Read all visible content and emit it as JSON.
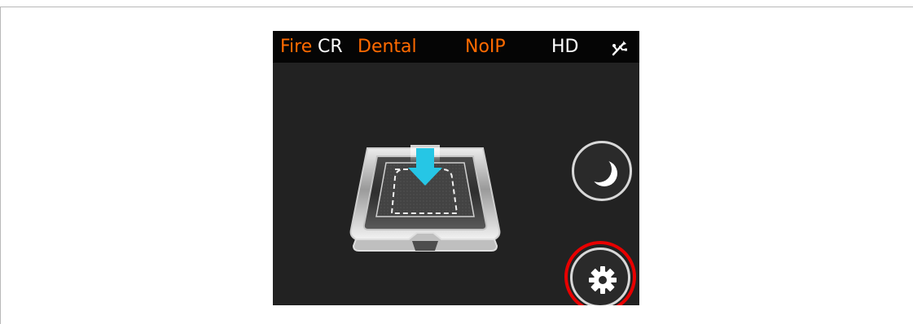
{
  "status_bar": {
    "brand_fire": "Fire",
    "brand_cr": "CR",
    "product": "Dental",
    "network": "NoIP",
    "mode": "HD",
    "connection_icon": "usb-icon"
  },
  "main": {
    "tray_icon": "plate-tray-icon",
    "sleep_icon": "moon-icon",
    "settings_icon": "gear-icon",
    "highlight_color": "#e80000",
    "accent_color": "#ff6a00",
    "arrow_color": "#22c7e6"
  }
}
